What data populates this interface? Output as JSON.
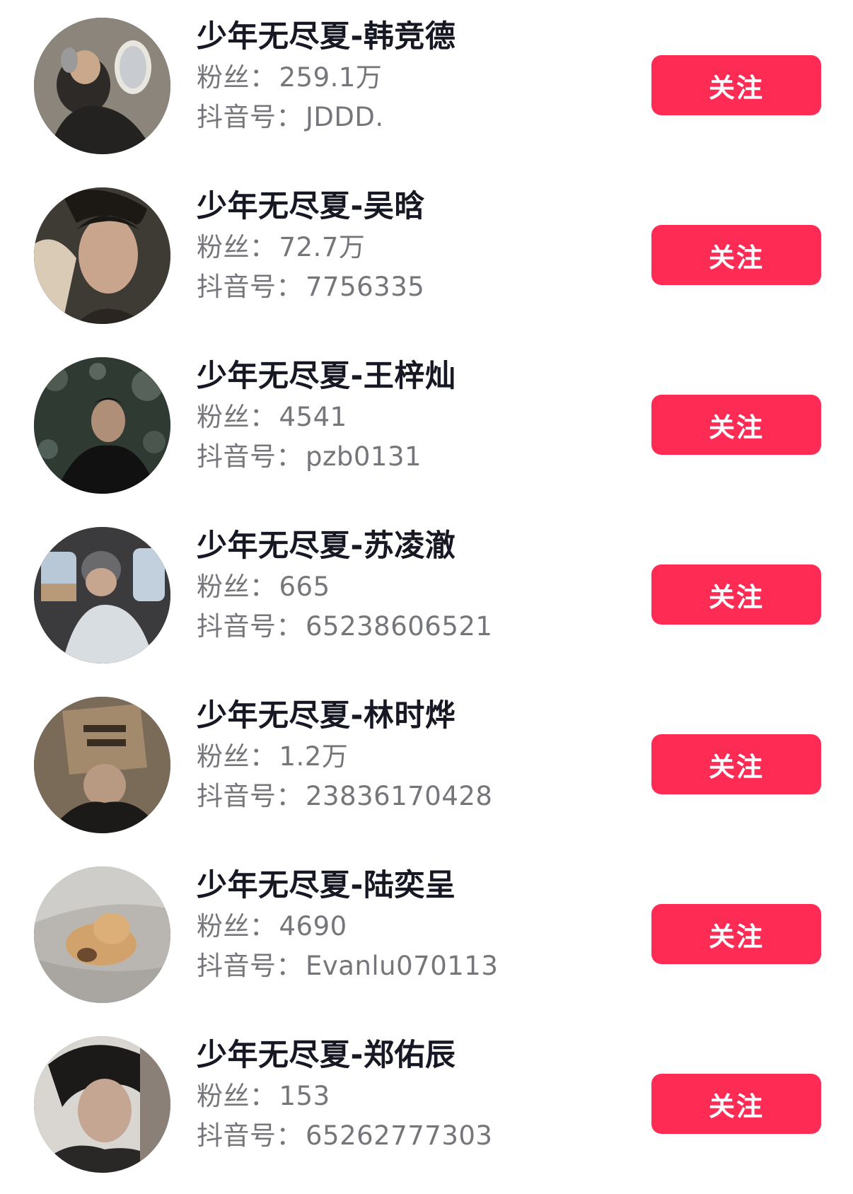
{
  "follow_color": "#fe2c55",
  "users": [
    {
      "name": "少年无尽夏-韩竞德",
      "fans_label": "粉丝：",
      "fans": "259.1万",
      "id_label": "抖音号：",
      "douyin_id": "JDDD.",
      "follow_label": "关注"
    },
    {
      "name": "少年无尽夏-吴晗",
      "fans_label": "粉丝：",
      "fans": "72.7万",
      "id_label": "抖音号：",
      "douyin_id": "7756335",
      "follow_label": "关注"
    },
    {
      "name": "少年无尽夏-王梓灿",
      "fans_label": "粉丝：",
      "fans": "4541",
      "id_label": "抖音号：",
      "douyin_id": "pzb0131",
      "follow_label": "关注"
    },
    {
      "name": "少年无尽夏-苏凌澈",
      "fans_label": "粉丝：",
      "fans": "665",
      "id_label": "抖音号：",
      "douyin_id": "65238606521",
      "follow_label": "关注"
    },
    {
      "name": "少年无尽夏-林时烨",
      "fans_label": "粉丝：",
      "fans": "1.2万",
      "id_label": "抖音号：",
      "douyin_id": "23836170428",
      "follow_label": "关注"
    },
    {
      "name": "少年无尽夏-陆奕呈",
      "fans_label": "粉丝：",
      "fans": "4690",
      "id_label": "抖音号：",
      "douyin_id": "Evanlu070113",
      "follow_label": "关注"
    },
    {
      "name": "少年无尽夏-郑佑辰",
      "fans_label": "粉丝：",
      "fans": "153",
      "id_label": "抖音号：",
      "douyin_id": "65262777303",
      "follow_label": "关注"
    }
  ]
}
